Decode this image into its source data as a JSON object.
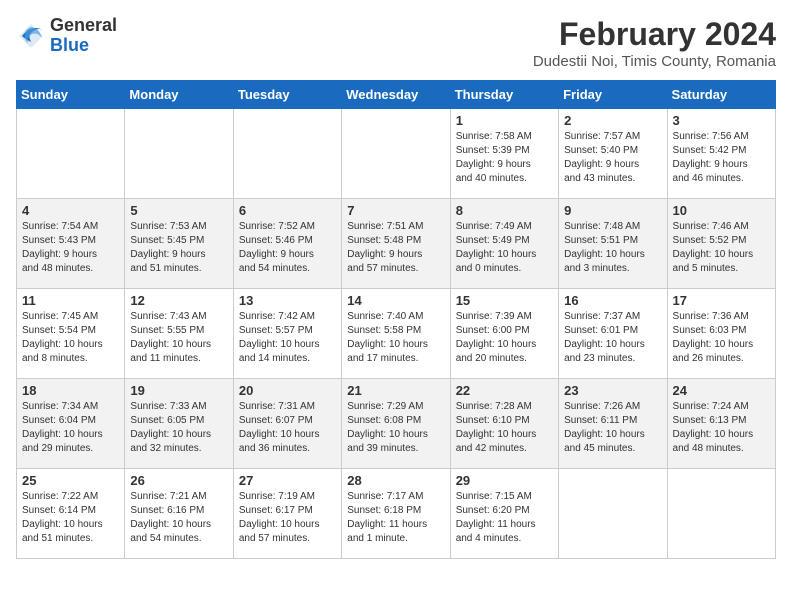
{
  "header": {
    "logo_general": "General",
    "logo_blue": "Blue",
    "title": "February 2024",
    "subtitle": "Dudestii Noi, Timis County, Romania"
  },
  "weekdays": [
    "Sunday",
    "Monday",
    "Tuesday",
    "Wednesday",
    "Thursday",
    "Friday",
    "Saturday"
  ],
  "weeks": [
    [
      {
        "day": "",
        "info": ""
      },
      {
        "day": "",
        "info": ""
      },
      {
        "day": "",
        "info": ""
      },
      {
        "day": "",
        "info": ""
      },
      {
        "day": "1",
        "info": "Sunrise: 7:58 AM\nSunset: 5:39 PM\nDaylight: 9 hours\nand 40 minutes."
      },
      {
        "day": "2",
        "info": "Sunrise: 7:57 AM\nSunset: 5:40 PM\nDaylight: 9 hours\nand 43 minutes."
      },
      {
        "day": "3",
        "info": "Sunrise: 7:56 AM\nSunset: 5:42 PM\nDaylight: 9 hours\nand 46 minutes."
      }
    ],
    [
      {
        "day": "4",
        "info": "Sunrise: 7:54 AM\nSunset: 5:43 PM\nDaylight: 9 hours\nand 48 minutes."
      },
      {
        "day": "5",
        "info": "Sunrise: 7:53 AM\nSunset: 5:45 PM\nDaylight: 9 hours\nand 51 minutes."
      },
      {
        "day": "6",
        "info": "Sunrise: 7:52 AM\nSunset: 5:46 PM\nDaylight: 9 hours\nand 54 minutes."
      },
      {
        "day": "7",
        "info": "Sunrise: 7:51 AM\nSunset: 5:48 PM\nDaylight: 9 hours\nand 57 minutes."
      },
      {
        "day": "8",
        "info": "Sunrise: 7:49 AM\nSunset: 5:49 PM\nDaylight: 10 hours\nand 0 minutes."
      },
      {
        "day": "9",
        "info": "Sunrise: 7:48 AM\nSunset: 5:51 PM\nDaylight: 10 hours\nand 3 minutes."
      },
      {
        "day": "10",
        "info": "Sunrise: 7:46 AM\nSunset: 5:52 PM\nDaylight: 10 hours\nand 5 minutes."
      }
    ],
    [
      {
        "day": "11",
        "info": "Sunrise: 7:45 AM\nSunset: 5:54 PM\nDaylight: 10 hours\nand 8 minutes."
      },
      {
        "day": "12",
        "info": "Sunrise: 7:43 AM\nSunset: 5:55 PM\nDaylight: 10 hours\nand 11 minutes."
      },
      {
        "day": "13",
        "info": "Sunrise: 7:42 AM\nSunset: 5:57 PM\nDaylight: 10 hours\nand 14 minutes."
      },
      {
        "day": "14",
        "info": "Sunrise: 7:40 AM\nSunset: 5:58 PM\nDaylight: 10 hours\nand 17 minutes."
      },
      {
        "day": "15",
        "info": "Sunrise: 7:39 AM\nSunset: 6:00 PM\nDaylight: 10 hours\nand 20 minutes."
      },
      {
        "day": "16",
        "info": "Sunrise: 7:37 AM\nSunset: 6:01 PM\nDaylight: 10 hours\nand 23 minutes."
      },
      {
        "day": "17",
        "info": "Sunrise: 7:36 AM\nSunset: 6:03 PM\nDaylight: 10 hours\nand 26 minutes."
      }
    ],
    [
      {
        "day": "18",
        "info": "Sunrise: 7:34 AM\nSunset: 6:04 PM\nDaylight: 10 hours\nand 29 minutes."
      },
      {
        "day": "19",
        "info": "Sunrise: 7:33 AM\nSunset: 6:05 PM\nDaylight: 10 hours\nand 32 minutes."
      },
      {
        "day": "20",
        "info": "Sunrise: 7:31 AM\nSunset: 6:07 PM\nDaylight: 10 hours\nand 36 minutes."
      },
      {
        "day": "21",
        "info": "Sunrise: 7:29 AM\nSunset: 6:08 PM\nDaylight: 10 hours\nand 39 minutes."
      },
      {
        "day": "22",
        "info": "Sunrise: 7:28 AM\nSunset: 6:10 PM\nDaylight: 10 hours\nand 42 minutes."
      },
      {
        "day": "23",
        "info": "Sunrise: 7:26 AM\nSunset: 6:11 PM\nDaylight: 10 hours\nand 45 minutes."
      },
      {
        "day": "24",
        "info": "Sunrise: 7:24 AM\nSunset: 6:13 PM\nDaylight: 10 hours\nand 48 minutes."
      }
    ],
    [
      {
        "day": "25",
        "info": "Sunrise: 7:22 AM\nSunset: 6:14 PM\nDaylight: 10 hours\nand 51 minutes."
      },
      {
        "day": "26",
        "info": "Sunrise: 7:21 AM\nSunset: 6:16 PM\nDaylight: 10 hours\nand 54 minutes."
      },
      {
        "day": "27",
        "info": "Sunrise: 7:19 AM\nSunset: 6:17 PM\nDaylight: 10 hours\nand 57 minutes."
      },
      {
        "day": "28",
        "info": "Sunrise: 7:17 AM\nSunset: 6:18 PM\nDaylight: 11 hours\nand 1 minute."
      },
      {
        "day": "29",
        "info": "Sunrise: 7:15 AM\nSunset: 6:20 PM\nDaylight: 11 hours\nand 4 minutes."
      },
      {
        "day": "",
        "info": ""
      },
      {
        "day": "",
        "info": ""
      }
    ]
  ]
}
